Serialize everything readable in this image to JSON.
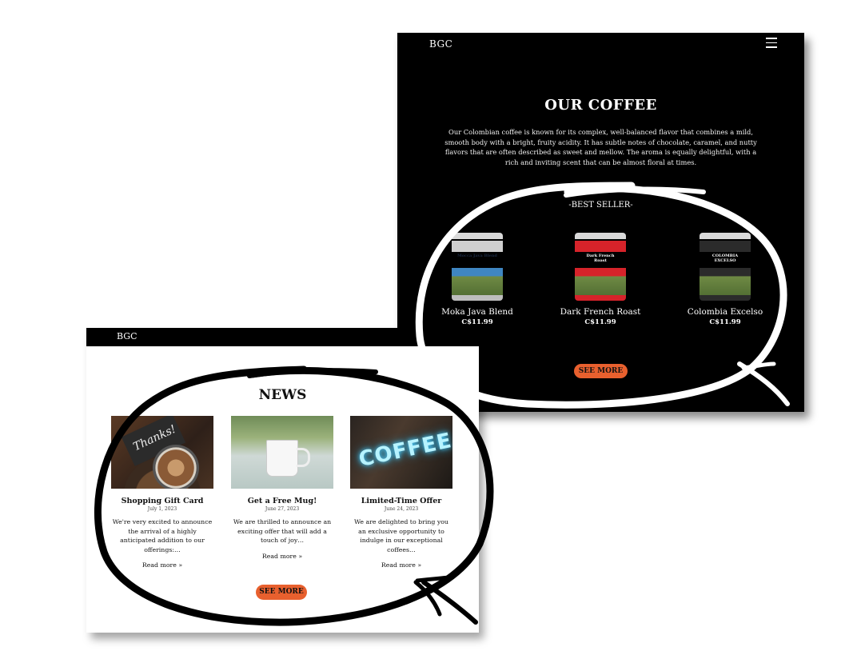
{
  "coffee_panel": {
    "brand": "BGC",
    "title": "OUR COFFEE",
    "description": "Our Colombian coffee is known for its complex, well-balanced flavor that combines a mild, smooth body with a bright, fruity acidity. It has subtle notes of chocolate, caramel, and nutty flavors that are often described as sweet and mellow. The aroma is equally delightful, with a rich and inviting scent that can be almost floral at times.",
    "best_seller_label": "-BEST SELLER-",
    "products": [
      {
        "name": "Moka Java Blend",
        "price": "C$11.99",
        "can_label": "Mocca Java Blend",
        "can_color": "#3f86c2"
      },
      {
        "name": "Dark French Roast",
        "price": "C$11.99",
        "can_label": "Dark French Roast",
        "can_color": "#d6232a"
      },
      {
        "name": "Colombia Excelso",
        "price": "C$11.99",
        "can_label": "COLOMBIA EXCELSO",
        "can_color": "#2b2b2b"
      }
    ],
    "see_more": "SEE MORE"
  },
  "news_panel": {
    "brand": "BGC",
    "title": "NEWS",
    "cards": [
      {
        "title": "Shopping Gift Card",
        "date": "July 1, 2023",
        "excerpt": "We're very excited to announce the arrival of a highly anticipated addition to our offerings:…",
        "read_more": "Read more »",
        "thumb_word": "Thanks!"
      },
      {
        "title": "Get a Free Mug!",
        "date": "June 27, 2023",
        "excerpt": "We are thrilled to announce an exciting offer that will add a touch of joy…",
        "read_more": "Read more »"
      },
      {
        "title": "Limited-Time Offer",
        "date": "June 24, 2023",
        "excerpt": "We are delighted to bring you an exclusive opportunity to indulge in our exceptional coffees…",
        "read_more": "Read more »",
        "thumb_word": "COFFEE"
      }
    ],
    "see_more": "SEE MORE"
  },
  "colors": {
    "accent": "#e8602e",
    "dark_bg": "#000000",
    "light_bg": "#ffffff"
  }
}
